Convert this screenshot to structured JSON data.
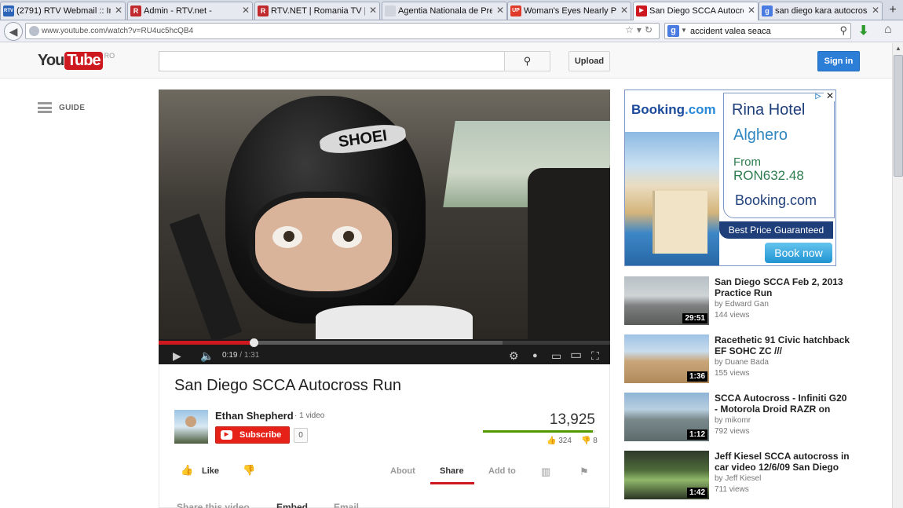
{
  "browser": {
    "tabs": [
      {
        "label": "(2791) RTV Webmail :: In...",
        "fav": "RTV",
        "color": "#2a63b8"
      },
      {
        "label": "Admin - RTV.net -",
        "fav": "R",
        "color": "#c0292d"
      },
      {
        "label": "RTV.NET | Romania TV | N...",
        "fav": "R",
        "color": "#c0292d"
      },
      {
        "label": "Agentia Nationala de Pres...",
        "fav": "",
        "color": "#cfd4dd"
      },
      {
        "label": "Woman's Eyes Nearly Pop...",
        "fav": "UP",
        "color": "#e03a2a"
      },
      {
        "label": "San Diego SCCA Autocros...",
        "fav": "▶",
        "color": "#cc181e",
        "active": true
      },
      {
        "label": "san diego kara autocross ...",
        "fav": "g",
        "color": "#4a7be0"
      }
    ],
    "new_tab": "+",
    "url": "www.youtube.com/watch?v=RU4uc5hcQB4",
    "search_engine": "g",
    "search_query": "accident valea seaca"
  },
  "masthead": {
    "logo_you": "You",
    "logo_tube": "Tube",
    "region": "RO",
    "search_placeholder": "",
    "upload_label": "Upload",
    "signin_label": "Sign in"
  },
  "guide": {
    "label": "GUIDE"
  },
  "player": {
    "current_time": "0:19",
    "duration": "1:31",
    "progress_fraction": 0.21,
    "buffered_fraction": 0.762
  },
  "video": {
    "title": "San Diego SCCA Autocross Run",
    "channel": "Ethan Shepherd",
    "channel_videos": "1 video",
    "subscribe_label": "Subscribe",
    "subscriber_count": "0",
    "views": "13,925",
    "likes": "324",
    "dislikes": "8",
    "like_ratio": 0.976,
    "like_label": "Like",
    "tabs": [
      "About",
      "Share",
      "Add to"
    ],
    "share_subnav": [
      "Share this video",
      "Embed",
      "Email"
    ]
  },
  "ad": {
    "brand": "Booking",
    "brand_suffix": ".com",
    "hotel": "Rina Hotel",
    "city": "Alghero",
    "from": "From",
    "price": "RON632.48",
    "brand2": "Booking.com",
    "tagline": "Best Price Guaranteed",
    "cta": "Book now",
    "close": "✕",
    "info": "▷"
  },
  "related": [
    {
      "title": "San Diego SCCA Feb 2, 2013 Practice Run",
      "by": "by Edward Gan",
      "views": "144 views",
      "duration": "29:51",
      "thumb": "linear-gradient(180deg,#b7c0c6 0%,#cfd4d6 40%,#7d7f80 60%,#5a5c5a 100%)"
    },
    {
      "title": "Racethetic 91 Civic hatchback EF SOHC ZC ///",
      "by": "by Duane Bada",
      "views": "155 views",
      "duration": "1:36",
      "thumb": "linear-gradient(180deg,#9ec2e6 0%,#c9dcec 35%,#c9a67a 55%,#b08a5a 100%)"
    },
    {
      "title": "SCCA Autocross - Infiniti G20 - Motorola Droid RAZR on",
      "by": "by mikomr",
      "views": "792 views",
      "duration": "1:12",
      "thumb": "linear-gradient(180deg,#8fb4d6 0%,#b8cfe0 35%,#7a8a8c 55%,#5d6a6c 100%)"
    },
    {
      "title": "Jeff Kiesel SCCA autocross in car video 12/6/09 San Diego",
      "by": "by Jeff Kiesel",
      "views": "711 views",
      "duration": "1:42",
      "thumb": "linear-gradient(180deg,#2f3a2a 0%,#4e6a3a 40%,#8fb86a 60%,#2a3322 100%)"
    }
  ]
}
